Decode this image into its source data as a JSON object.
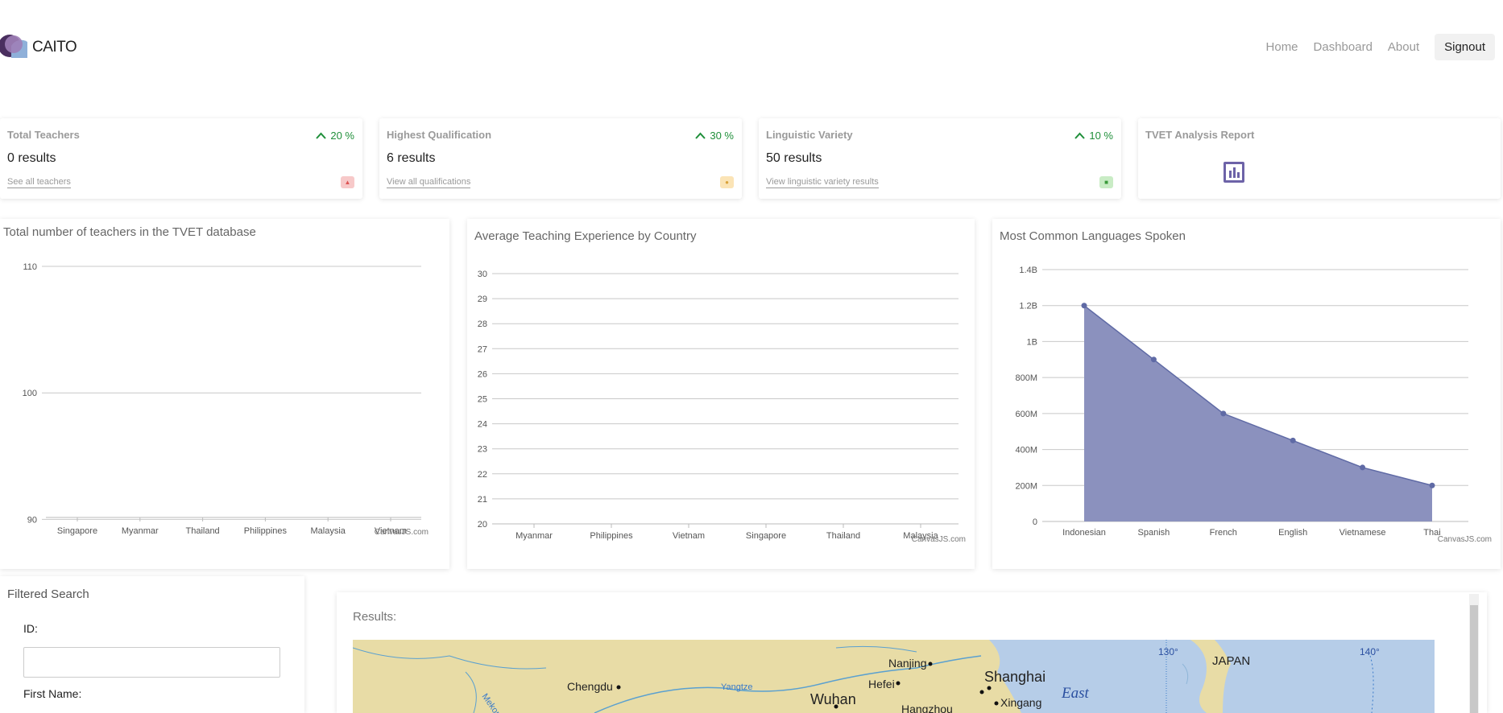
{
  "nav": {
    "brand": "CAITO",
    "links": [
      "Home",
      "Dashboard",
      "About"
    ],
    "signout": "Signout"
  },
  "cards": [
    {
      "title": "Total Teachers",
      "trend": "20 %",
      "value": "0 results",
      "link": "See all teachers",
      "badge_color": "#f7c9c9"
    },
    {
      "title": "Highest Qualification",
      "trend": "30 %",
      "value": "6 results",
      "link": "View all qualifications",
      "badge_color": "#fbe4b6"
    },
    {
      "title": "Linguistic Variety",
      "trend": "10 %",
      "value": "50 results",
      "link": "View linguistic variety results",
      "badge_color": "#c9ecc5"
    },
    {
      "title": "TVET Analysis Report",
      "icon": "bar-chart-icon"
    }
  ],
  "colors": {
    "trend_up": "#1f8f3a",
    "accent_purple": "#6d63a8",
    "area_fill": "#8b91be",
    "area_line": "#5f6aa5"
  },
  "chart_data": [
    {
      "type": "bar",
      "title": "Total number of teachers in the TVET database",
      "categories": [
        "Singapore",
        "Myanmar",
        "Thailand",
        "Philippines",
        "Malaysia",
        "Vietnam"
      ],
      "values": [],
      "y_ticks": [
        "90",
        "100",
        "110"
      ],
      "ylim": [
        85,
        110
      ],
      "grid": true,
      "credit": "CanvasJS.com"
    },
    {
      "type": "bar",
      "title": "Average Teaching Experience by Country",
      "categories": [
        "Myanmar",
        "Philippines",
        "Vietnam",
        "Singapore",
        "Thailand",
        "Malaysia"
      ],
      "values": [],
      "y_ticks": [
        "20",
        "21",
        "22",
        "23",
        "24",
        "25",
        "26",
        "27",
        "28",
        "29",
        "30"
      ],
      "ylim": [
        20,
        30
      ],
      "grid": true,
      "credit": "CanvasJS.com"
    },
    {
      "type": "area",
      "title": "Most Common Languages Spoken",
      "categories": [
        "Indonesian",
        "Spanish",
        "French",
        "English",
        "Vietnamese",
        "Thai"
      ],
      "values": [
        1200000000,
        900000000,
        600000000,
        450000000,
        300000000,
        200000000
      ],
      "y_ticks": [
        "0",
        "200M",
        "400M",
        "600M",
        "800M",
        "1B",
        "1.2B",
        "1.4B"
      ],
      "ylim": [
        0,
        1400000000
      ],
      "grid": true,
      "credit": "CanvasJS.com"
    }
  ],
  "filter": {
    "title": "Filtered Search",
    "fields": [
      {
        "label": "ID:",
        "value": ""
      },
      {
        "label": "First Name:"
      }
    ]
  },
  "results": {
    "title": "Results:",
    "map_labels": {
      "cities": [
        "Nanjing",
        "Hefei",
        "Shanghai",
        "Xingang",
        "Chengdu",
        "Wuhan",
        "Hangzhou"
      ],
      "rivers": [
        "Yangtze",
        "Mekong"
      ],
      "regions": [
        "JAPAN",
        "East"
      ],
      "graticule": [
        "130°",
        "140°"
      ]
    }
  }
}
